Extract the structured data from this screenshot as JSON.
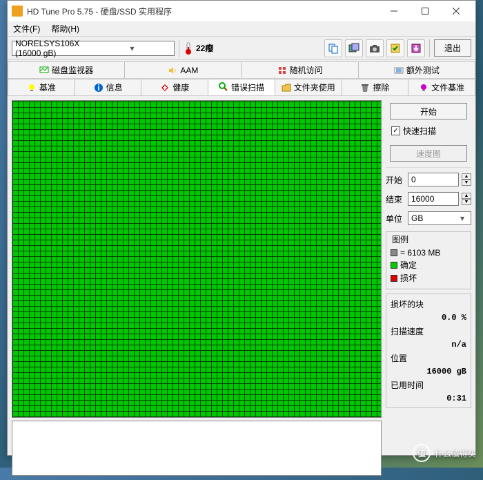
{
  "window": {
    "title": "HD Tune Pro 5.75 - 硬盘/SSD 实用程序",
    "menu": {
      "file": "文件(F)",
      "help": "帮助(H)"
    }
  },
  "toolbar": {
    "drive": "NORELSYS106X (16000 gB)",
    "temp": "22癈",
    "exit": "退出"
  },
  "tabs_top": {
    "monitor": "磁盘监视器",
    "aam": "AAM",
    "random": "随机访问",
    "extra": "额外测试"
  },
  "tabs_bottom": {
    "benchmark": "基准",
    "info": "信息",
    "health": "健康",
    "errorscan": "错误扫描",
    "folder": "文件夹使用",
    "erase": "擦除",
    "filebench": "文件基准"
  },
  "panel": {
    "start": "开始",
    "quickscan": "快速扫描",
    "speedmap": "速度图",
    "start_label": "开始",
    "start_val": "0",
    "end_label": "结束",
    "end_val": "16000",
    "unit_label": "单位",
    "unit_val": "GB",
    "legend_title": "图例",
    "legend_block": "= 6103 MB",
    "legend_ok": "确定",
    "legend_bad": "损坏",
    "damaged_label": "损坏的块",
    "damaged_val": "0.0 %",
    "speed_label": "扫描速度",
    "speed_val": "n/a",
    "position_label": "位置",
    "position_val": "16000 gB",
    "elapsed_label": "已用时间",
    "elapsed_val": "0:31"
  },
  "watermark": "什么值得买"
}
